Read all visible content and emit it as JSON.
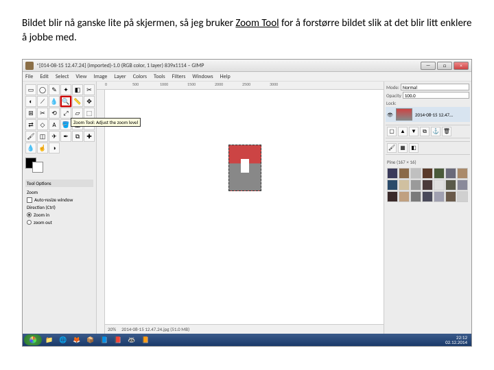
{
  "caption": {
    "pre": "Bildet blir nå ganske lite på skjermen, så jeg bruker ",
    "em": "Zoom Tool",
    "post": " for å forstørre bildet slik at det blir litt enklere å jobbe med."
  },
  "window": {
    "title": "*[014-08-15 12.47.24] (imported)-1.0 (RGB color, 1 layer) 839x1114 – GIMP",
    "min": "—",
    "max": "□",
    "close": "×"
  },
  "menu": [
    "File",
    "Edit",
    "Select",
    "View",
    "Image",
    "Layer",
    "Colors",
    "Tools",
    "Filters",
    "Windows",
    "Help"
  ],
  "tooltip": "Zoom Tool: Adjust the zoom level",
  "toolOptions": {
    "title": "Tool Options",
    "section": "Zoom",
    "autoResize": "Auto-resize window",
    "direction": "Direction (Ctrl)",
    "zoomIn": "Zoom in",
    "zoomOut": "zoom out"
  },
  "rulerH": [
    "0",
    "500",
    "1000",
    "1500",
    "2000",
    "2500",
    "3000"
  ],
  "status": {
    "zoom": "20%",
    "info": "2014-08-15 12.47.24.jpg (51.0 MB)"
  },
  "right": {
    "modeLabel": "Mode:",
    "modeValue": "Normal",
    "opacityLabel": "Opacity",
    "opacityValue": "100.0",
    "lockLabel": "Lock:",
    "layerName": "2014-08-15 12.47…",
    "patternLabel": "Pine (167 × 16)"
  },
  "patterns": [
    "#3a3a5a",
    "#8a6a4a",
    "#c0c0c0",
    "#5a3a2a",
    "#4a5a3a",
    "#6a6a7a",
    "#aa8a6a",
    "#2a4a6a",
    "#d0c0a0",
    "#9a9a9a",
    "#4a3a3a",
    "#e0e0e0",
    "#5a5a4a",
    "#8a8a9a",
    "#3a2a2a",
    "#c0a080",
    "#7a7a7a",
    "#4a4a5a",
    "#a0a0b0",
    "#6a5a4a",
    "#d0d0d0"
  ],
  "clock": {
    "time": "22:12",
    "date": "02.12.2014"
  }
}
